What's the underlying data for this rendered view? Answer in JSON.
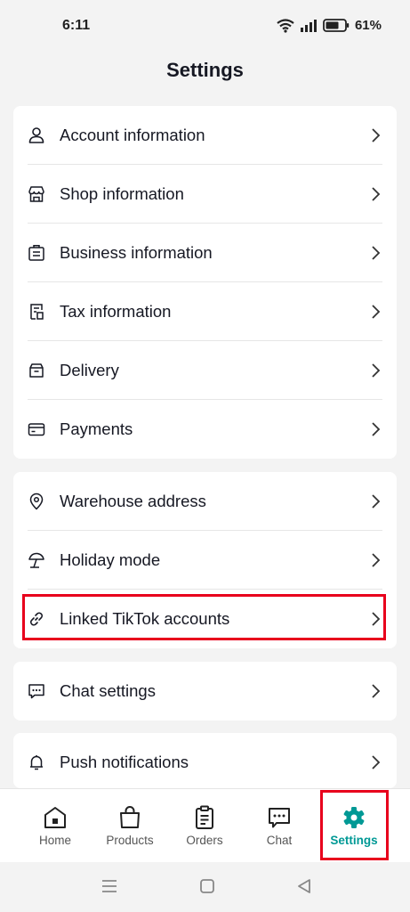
{
  "status": {
    "time": "6:11",
    "battery": "61%"
  },
  "header": {
    "title": "Settings"
  },
  "groups": [
    [
      {
        "label": "Account information",
        "icon": "user-icon"
      },
      {
        "label": "Shop information",
        "icon": "shop-icon"
      },
      {
        "label": "Business information",
        "icon": "briefcase-icon"
      },
      {
        "label": "Tax information",
        "icon": "document-icon"
      },
      {
        "label": "Delivery",
        "icon": "box-icon"
      },
      {
        "label": "Payments",
        "icon": "card-icon"
      }
    ],
    [
      {
        "label": "Warehouse address",
        "icon": "location-pin-icon"
      },
      {
        "label": "Holiday mode",
        "icon": "beach-umbrella-icon"
      },
      {
        "label": "Linked TikTok accounts",
        "icon": "link-icon"
      }
    ],
    [
      {
        "label": "Chat settings",
        "icon": "chat-icon"
      }
    ],
    [
      {
        "label": "Push notifications",
        "icon": "bell-icon"
      }
    ]
  ],
  "tabbar": {
    "items": [
      {
        "label": "Home",
        "icon": "home-icon"
      },
      {
        "label": "Products",
        "icon": "shopping-bag-icon"
      },
      {
        "label": "Orders",
        "icon": "clipboard-icon"
      },
      {
        "label": "Chat",
        "icon": "chat-bubble-icon"
      },
      {
        "label": "Settings",
        "icon": "gear-icon",
        "active": true
      }
    ],
    "accent_color": "#009995"
  },
  "highlight_color": "#e8001c"
}
